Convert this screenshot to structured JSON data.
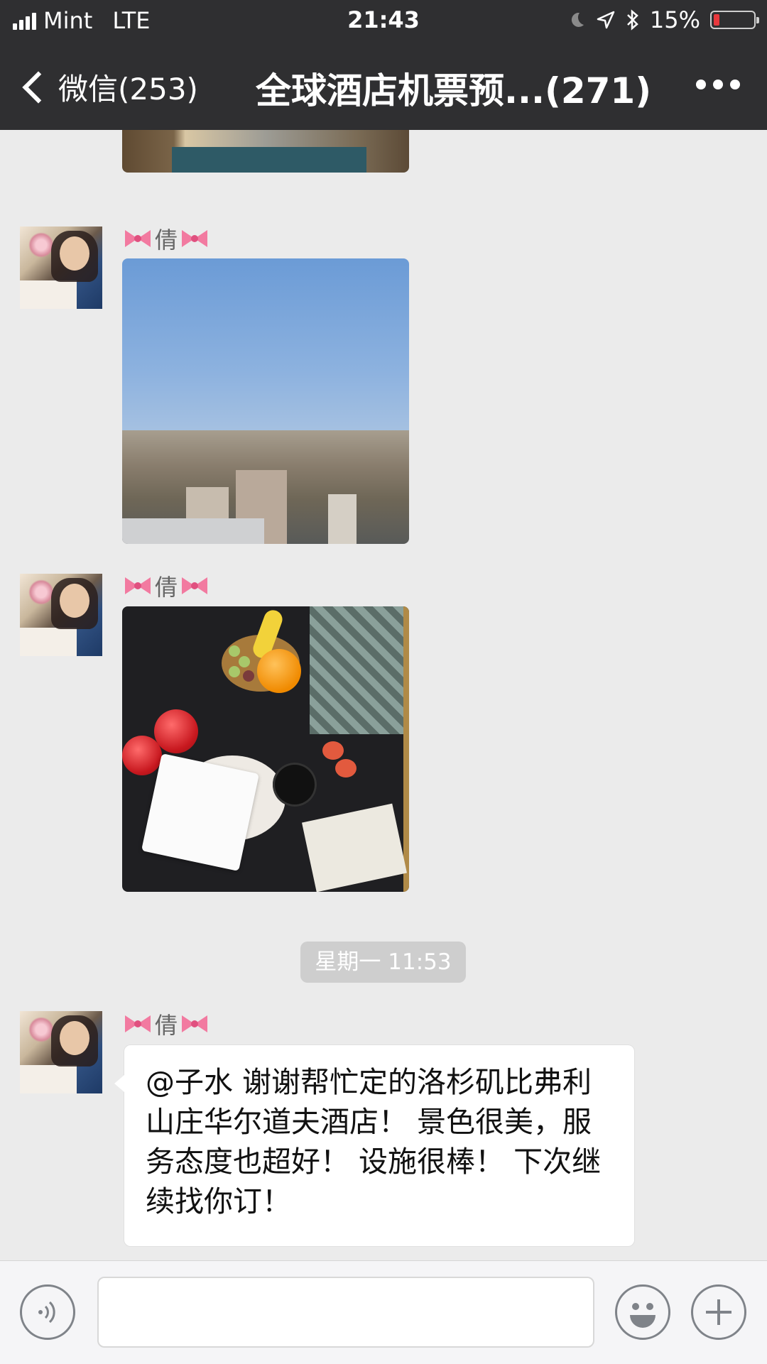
{
  "status_bar": {
    "carrier": "Mint",
    "network": "LTE",
    "time": "21:43",
    "battery": "15%",
    "battery_level": 0.15
  },
  "nav": {
    "back_label": "微信(253)",
    "title": "全球酒店机票预...(271)",
    "more_icon": "more-dots-icon"
  },
  "messages": [
    {
      "type": "image",
      "sender": "倩",
      "image": "hotel-room-photo"
    },
    {
      "type": "image",
      "sender": "倩",
      "image": "city-view-photo"
    },
    {
      "type": "image",
      "sender": "倩",
      "image": "fruit-tray-photo"
    },
    {
      "type": "timestamp",
      "text": "星期一 11:53"
    },
    {
      "type": "text",
      "sender": "倩",
      "text": "@子水 谢谢帮忙定的洛杉矶比弗利山庄华尔道夫酒店！ 景色很美，服务态度也超好！ 设施很棒！ 下次继续找你订！"
    }
  ],
  "sender_decoration": "pink-bow-icon",
  "colors": {
    "nav_background": "#2f2f31",
    "chat_background": "#ebebeb",
    "bubble_background": "#ffffff",
    "battery_low": "#e8383d"
  },
  "input_bar": {
    "voice_icon": "voice-icon",
    "emoji_icon": "emoji-icon",
    "plus_icon": "plus-icon",
    "text_value": ""
  }
}
